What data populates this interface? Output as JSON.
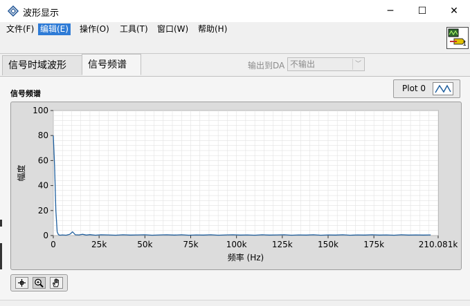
{
  "window": {
    "title": "波形显示",
    "controls": {
      "minimize": "─",
      "maximize": "☐",
      "close": "✕"
    }
  },
  "menu": [
    {
      "label": "文件(F)"
    },
    {
      "label": "编辑(E)"
    },
    {
      "label": "操作(O)"
    },
    {
      "label": "工具(T)"
    },
    {
      "label": "窗口(W)"
    },
    {
      "label": "帮助(H)"
    }
  ],
  "vi_icon": {
    "label": "1"
  },
  "tabs": [
    {
      "label": "信号时域波形"
    },
    {
      "label": "信号频谱"
    }
  ],
  "output": {
    "label": "输出到DA",
    "value": "不输出",
    "arrow": "﹀"
  },
  "graph": {
    "label": "信号频谱",
    "legend": "Plot 0"
  },
  "chart_data": {
    "type": "line",
    "title": "",
    "xlabel": "频率 (Hz)",
    "ylabel": "幅度",
    "xlim": [
      0,
      210081
    ],
    "ylim": [
      0,
      100
    ],
    "x_ticks": [
      0,
      25000,
      50000,
      75000,
      100000,
      125000,
      150000,
      175000,
      210081
    ],
    "x_tick_labels": [
      "0",
      "25k",
      "50k",
      "75k",
      "100k",
      "125k",
      "150k",
      "175k",
      "210.081k"
    ],
    "y_ticks": [
      0,
      20,
      40,
      60,
      80,
      100
    ],
    "y_tick_labels": [
      "0",
      "20",
      "40",
      "60",
      "80",
      "100"
    ],
    "grid": true,
    "line_color": "#1f5f9e",
    "plot_bg": "#ffffff",
    "grid_color": "#e2e2e2",
    "series": [
      {
        "x": [
          0,
          700,
          1400,
          2100,
          2800,
          3500,
          5000,
          7000,
          9000,
          10500,
          12000,
          14000,
          16000,
          18000,
          20000,
          23000,
          26000,
          30000,
          34000,
          38000,
          42000,
          46000,
          50000,
          54000,
          58000,
          62000,
          66000,
          70000,
          74000,
          78000,
          82000,
          86000,
          90000,
          94000,
          98000,
          102000,
          106000,
          110000,
          114000,
          118000,
          122000,
          126000,
          130000,
          134000,
          138000,
          142000,
          146000,
          150000,
          154000,
          158000,
          162000,
          166000,
          170000,
          174000,
          178000,
          182000,
          186000,
          190000,
          194000,
          198000,
          202000,
          206000
        ],
        "y": [
          80,
          55,
          20,
          3,
          0.8,
          0.3,
          0.5,
          0.3,
          1,
          3,
          0.6,
          0.5,
          1,
          0.4,
          0.7,
          0.3,
          0.6,
          0.5,
          0.3,
          0.6,
          0.4,
          0.5,
          0.6,
          0.3,
          0.5,
          0.6,
          0.4,
          0.6,
          0.3,
          0.5,
          0.4,
          0.6,
          0.3,
          0.5,
          0.6,
          0.4,
          0.5,
          0.3,
          0.6,
          0.4,
          0.5,
          0.6,
          0.3,
          0.5,
          0.4,
          0.6,
          0.3,
          0.5,
          0.4,
          0.6,
          0.3,
          0.5,
          0.4,
          0.6,
          0.4,
          0.5,
          0.3,
          0.6,
          0.4,
          0.5,
          0.4,
          0.5
        ]
      }
    ]
  },
  "palette": [
    {
      "icon": "crosshair-icon"
    },
    {
      "icon": "zoom-icon"
    },
    {
      "icon": "pan-hand-icon"
    }
  ]
}
